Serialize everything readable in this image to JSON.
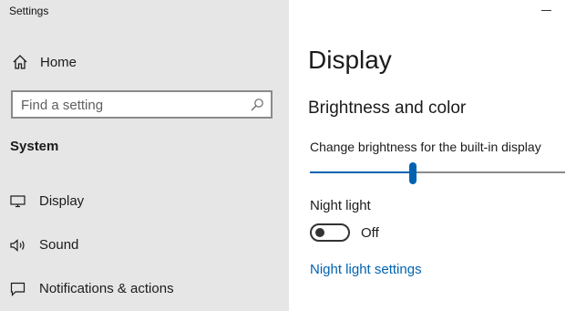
{
  "window": {
    "title": "Settings"
  },
  "sidebar": {
    "home": {
      "label": "Home",
      "icon": "home-icon"
    },
    "search": {
      "placeholder": "Find a setting",
      "value": "",
      "icon": "search-icon"
    },
    "section": "System",
    "items": [
      {
        "label": "Display",
        "icon": "monitor-icon"
      },
      {
        "label": "Sound",
        "icon": "speaker-icon"
      },
      {
        "label": "Notifications & actions",
        "icon": "notification-icon"
      }
    ]
  },
  "main": {
    "title": "Display",
    "section": "Brightness and color",
    "brightness": {
      "label": "Change brightness for the built-in display",
      "value_fraction": 0.405
    },
    "night_light": {
      "label": "Night light",
      "state": "Off",
      "enabled": false
    },
    "night_light_link": "Night light settings"
  },
  "colors": {
    "accent": "#0063b1",
    "sidebar_bg": "#e6e6e6",
    "main_bg": "#ffffff"
  }
}
